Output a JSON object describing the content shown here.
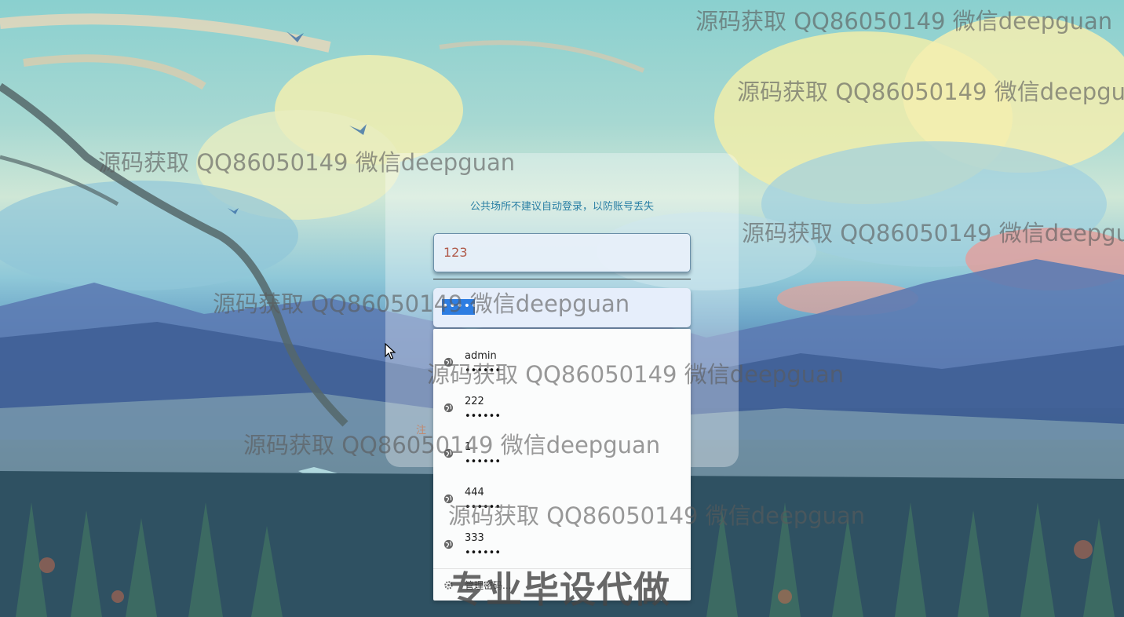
{
  "login": {
    "notice": "公共场所不建议自动登录，以防账号丢失",
    "username_value": "123",
    "password_value": "••••••",
    "register_hint": "注"
  },
  "autofill": {
    "items": [
      {
        "username": "admin",
        "password": "••••••"
      },
      {
        "username": "222",
        "password": "••••••"
      },
      {
        "username": "1",
        "password": "••••••"
      },
      {
        "username": "444",
        "password": "••••••"
      },
      {
        "username": "333",
        "password": "••••••"
      }
    ],
    "manage_label": "管理密码..."
  },
  "watermarks": {
    "text": "源码获取 QQ86050149 微信deepguan",
    "promo": "专业毕设代做"
  },
  "colors": {
    "accent_blue": "#2d7de2",
    "notice_text": "#2a7fa4"
  }
}
